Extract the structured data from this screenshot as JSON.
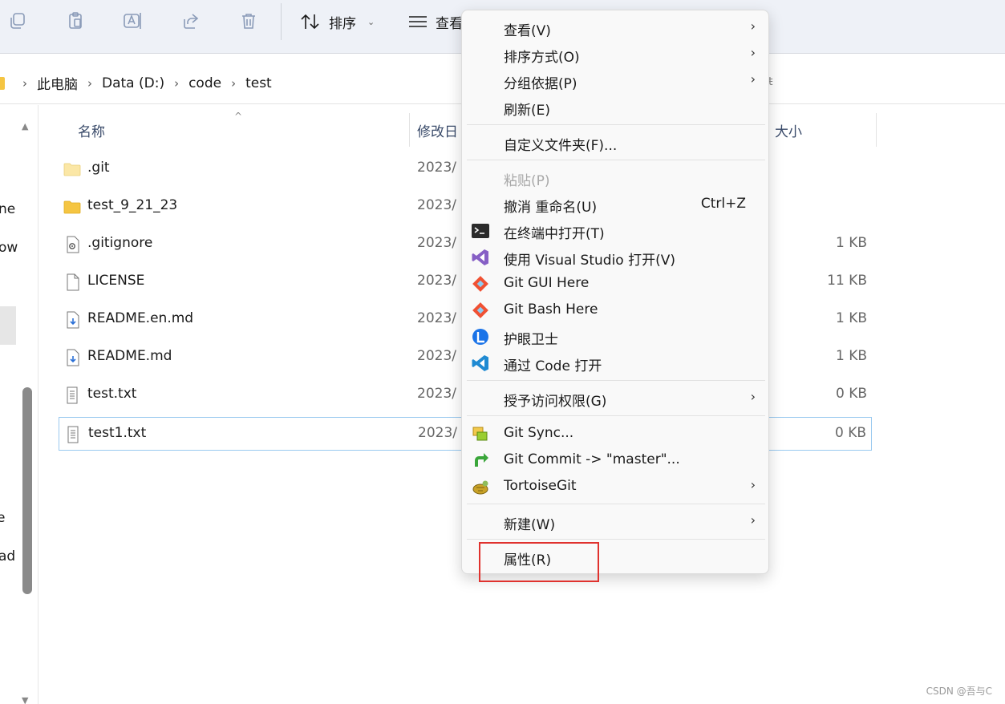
{
  "toolbar": {
    "icons": [
      "copy-icon",
      "paste-icon",
      "rename-icon",
      "share-icon",
      "delete-icon"
    ],
    "sort_label": "排序",
    "view_label": "查看"
  },
  "address": {
    "crumbs": [
      "此电脑",
      "Data (D:)",
      "code",
      "test"
    ],
    "right_fragment": "ŧ"
  },
  "leftnav": {
    "fragments": [
      "ne",
      "ow",
      "e",
      "ad"
    ]
  },
  "columns": {
    "name": "名称",
    "modified": "修改日",
    "size": "大小"
  },
  "files": [
    {
      "name": ".git",
      "date": "2023/",
      "size": "",
      "icon": "folder-light-icon"
    },
    {
      "name": "test_9_21_23",
      "date": "2023/",
      "size": "",
      "icon": "folder-icon"
    },
    {
      "name": ".gitignore",
      "date": "2023/",
      "size": "1 KB",
      "icon": "settings-file-icon"
    },
    {
      "name": "LICENSE",
      "date": "2023/",
      "size": "11 KB",
      "icon": "blank-file-icon"
    },
    {
      "name": "README.en.md",
      "date": "2023/",
      "size": "1 KB",
      "icon": "markdown-file-icon"
    },
    {
      "name": "README.md",
      "date": "2023/",
      "size": "1 KB",
      "icon": "markdown-file-icon"
    },
    {
      "name": "test.txt",
      "date": "2023/",
      "size": "0 KB",
      "icon": "text-file-icon"
    },
    {
      "name": "test1.txt",
      "date": "2023/",
      "size": "0 KB",
      "icon": "text-file-icon"
    }
  ],
  "context_menu": {
    "view": "查看(V)",
    "sort_by": "排序方式(O)",
    "group_by": "分组依据(P)",
    "refresh": "刷新(E)",
    "customize": "自定义文件夹(F)...",
    "paste": "粘贴(P)",
    "undo": "撤消 重命名(U)",
    "undo_shortcut": "Ctrl+Z",
    "open_terminal": "在终端中打开(T)",
    "open_vs": "使用 Visual Studio 打开(V)",
    "git_gui": "Git GUI Here",
    "git_bash": "Git Bash Here",
    "eye_guard": "护眼卫士",
    "open_code": "通过 Code 打开",
    "grant_access": "授予访问权限(G)",
    "git_sync": "Git Sync...",
    "git_commit": "Git Commit -> \"master\"...",
    "tortoise": "TortoiseGit",
    "new": "新建(W)",
    "properties": "属性(R)"
  },
  "watermark": "CSDN @吾与C",
  "colors": {
    "highlight": "#e0322e",
    "selection_border": "#99c9ef",
    "folder": "#f5c542"
  }
}
